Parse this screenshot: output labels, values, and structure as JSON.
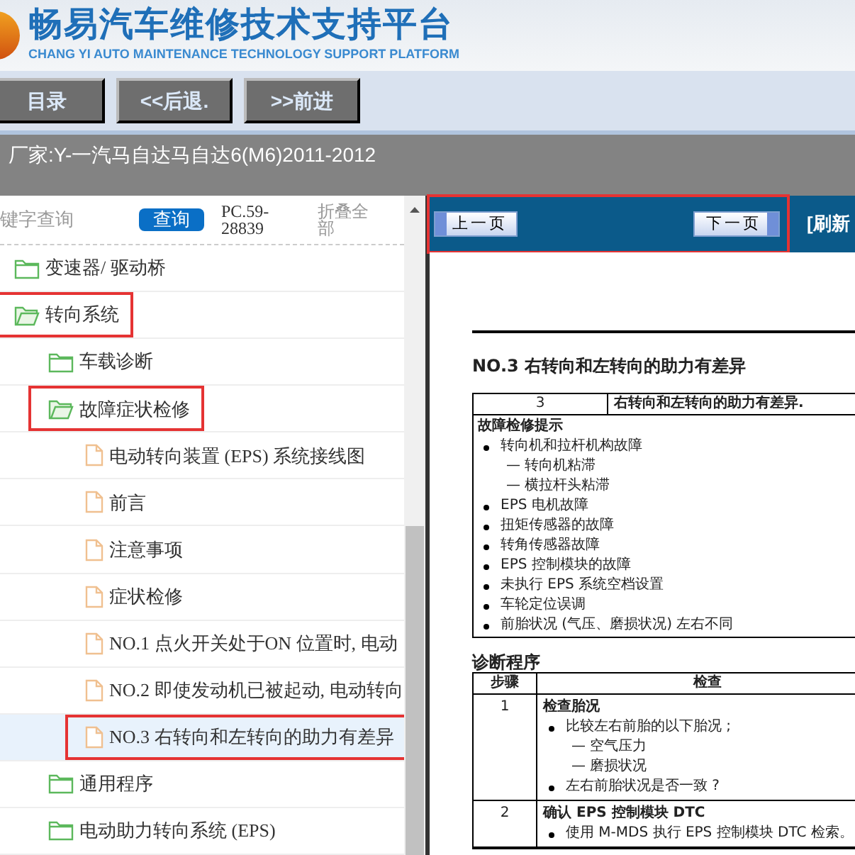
{
  "header": {
    "title": "畅易汽车维修技术支持平台",
    "subtitle": "CHANG YI AUTO MAINTENANCE TECHNOLOGY SUPPORT PLATFORM"
  },
  "nav": [
    "目录",
    "<<后退.",
    ">>前进"
  ],
  "breadcrumb": "厂家:Y-一汽马自达马自达6(M6)2011-2012",
  "search": {
    "placeholder": "键字查询",
    "button": "查询",
    "code": "PC.59-28839",
    "collapse": "折叠全部"
  },
  "tree": [
    {
      "kind": "folder",
      "label": "变速器/ 驱动桥",
      "expanded": false,
      "highlighted": false,
      "selected": false
    },
    {
      "kind": "folder",
      "label": "转向系统",
      "expanded": true,
      "highlighted": true,
      "selected": false,
      "children": [
        {
          "kind": "folder",
          "label": "车载诊断",
          "expanded": false,
          "highlighted": false,
          "selected": false
        },
        {
          "kind": "folder",
          "label": "故障症状检修",
          "expanded": true,
          "highlighted": true,
          "selected": false,
          "children": [
            {
              "kind": "doc",
              "label": "电动转向装置 (EPS) 系统接线图",
              "highlighted": false,
              "selected": false
            },
            {
              "kind": "doc",
              "label": "前言",
              "highlighted": false,
              "selected": false
            },
            {
              "kind": "doc",
              "label": "注意事项",
              "highlighted": false,
              "selected": false
            },
            {
              "kind": "doc",
              "label": "症状检修",
              "highlighted": false,
              "selected": false
            },
            {
              "kind": "doc",
              "label": "NO.1 点火开关处于ON 位置时, 电动",
              "highlighted": false,
              "selected": false
            },
            {
              "kind": "doc",
              "label": "NO.2 即使发动机已被起动, 电动转向",
              "highlighted": false,
              "selected": false
            },
            {
              "kind": "doc",
              "label": "NO.3 右转向和左转向的助力有差异",
              "highlighted": true,
              "selected": true
            }
          ]
        },
        {
          "kind": "folder",
          "label": "通用程序",
          "expanded": false,
          "highlighted": false,
          "selected": false
        },
        {
          "kind": "folder",
          "label": "电动助力转向系统 (EPS)",
          "expanded": false,
          "highlighted": false,
          "selected": false
        }
      ]
    }
  ],
  "viewer": {
    "toolbar": {
      "prev": "上一页",
      "next": "下一页",
      "refresh": "[刷新",
      "highlighted": true
    },
    "document": {
      "title": "NO.3 右转向和左转向的助力有差异",
      "summary": {
        "number": "3",
        "text": "右转向和左转向的助力有差异."
      },
      "hints": {
        "heading": "故障检修提示",
        "items": [
          {
            "kind": "bullet",
            "text": "转向机和拉杆机构故障"
          },
          {
            "kind": "dash",
            "text": "— 转向机粘滞"
          },
          {
            "kind": "dash",
            "text": "— 横拉杆头粘滞"
          },
          {
            "kind": "bullet",
            "text": "EPS 电机故障"
          },
          {
            "kind": "bullet",
            "text": "扭矩传感器的故障"
          },
          {
            "kind": "bullet",
            "text": "转角传感器故障"
          },
          {
            "kind": "bullet",
            "text": "EPS 控制模块的故障"
          },
          {
            "kind": "bullet",
            "text": "未执行 EPS 系统空档设置"
          },
          {
            "kind": "bullet",
            "text": "车轮定位误调"
          },
          {
            "kind": "bullet",
            "text": "前胎状况 (气压、磨损状况) 左右不同"
          }
        ]
      },
      "procedure": {
        "heading": "诊断程序",
        "columns": [
          "步骤",
          "检查"
        ],
        "rows": [
          {
            "step": "1",
            "heading": "检查胎况",
            "items": [
              {
                "kind": "bullet",
                "text": "比较左右前胎的以下胎况 ;"
              },
              {
                "kind": "dash",
                "text": "— 空气压力"
              },
              {
                "kind": "dash",
                "text": "— 磨损状况"
              },
              {
                "kind": "bullet",
                "text": "左右前胎状况是否一致 ?"
              }
            ]
          },
          {
            "step": "2",
            "heading": "确认 EPS 控制模块 DTC",
            "items": [
              {
                "kind": "bullet",
                "text": "使用 M-MDS 执行 EPS 控制模块 DTC 检索。"
              }
            ]
          }
        ]
      }
    }
  }
}
